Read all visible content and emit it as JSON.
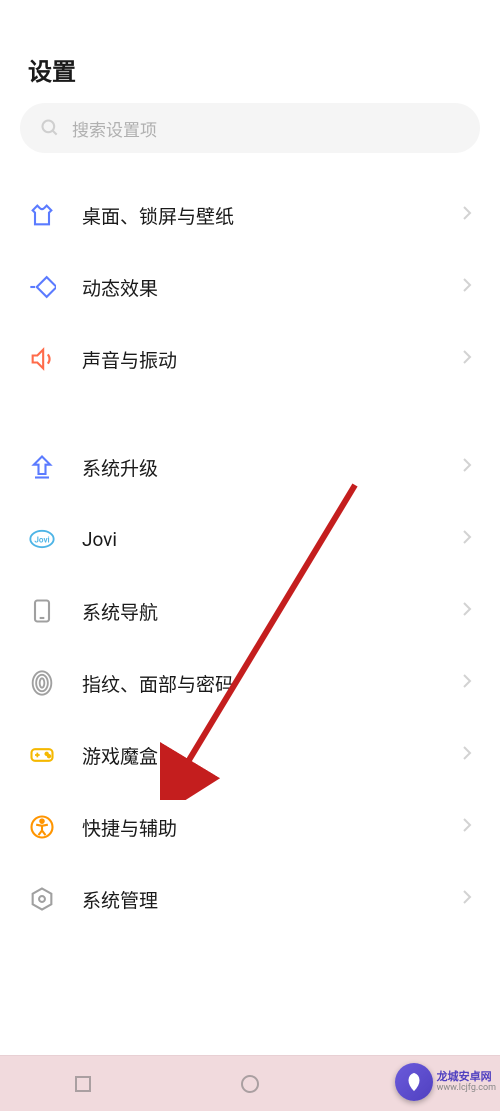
{
  "title": "设置",
  "search": {
    "placeholder": "搜索设置项"
  },
  "groups": [
    {
      "items": [
        {
          "icon": "shirt",
          "label": "桌面、锁屏与壁纸",
          "iconColor": "#5b7bff"
        },
        {
          "icon": "animation",
          "label": "动态效果",
          "iconColor": "#5b7bff"
        },
        {
          "icon": "sound",
          "label": "声音与振动",
          "iconColor": "#ff6b4a"
        }
      ]
    },
    {
      "items": [
        {
          "icon": "upgrade",
          "label": "系统升级",
          "iconColor": "#5b7bff"
        },
        {
          "icon": "jovi",
          "label": "Jovi",
          "iconColor": "#4db4e6"
        },
        {
          "icon": "navigation",
          "label": "系统导航",
          "iconColor": "#a0a0a0"
        },
        {
          "icon": "fingerprint",
          "label": "指纹、面部与密码",
          "iconColor": "#a0a0a0"
        },
        {
          "icon": "gamebox",
          "label": "游戏魔盒",
          "iconColor": "#f5b800"
        },
        {
          "icon": "accessibility",
          "label": "快捷与辅助",
          "iconColor": "#ff9500"
        },
        {
          "icon": "system",
          "label": "系统管理",
          "iconColor": "#a0a0a0"
        }
      ]
    }
  ],
  "watermark": {
    "name": "龙城安卓网",
    "url": "www.lcjfg.com"
  }
}
